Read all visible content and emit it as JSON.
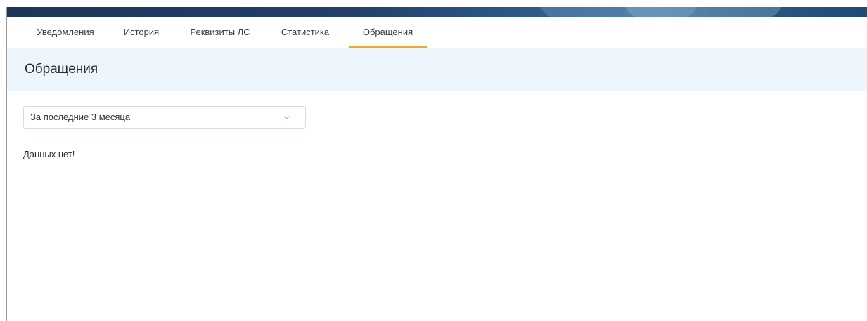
{
  "tabs": [
    {
      "label": "Уведомления",
      "active": false
    },
    {
      "label": "История",
      "active": false
    },
    {
      "label": "Реквизиты ЛС",
      "active": false
    },
    {
      "label": "Статистика",
      "active": false
    },
    {
      "label": "Обращения",
      "active": true
    }
  ],
  "section": {
    "title": "Обращения"
  },
  "filter": {
    "selected_value": "За последние 3 месяца"
  },
  "content": {
    "empty_message": "Данных нет!"
  },
  "colors": {
    "active_tab_indicator": "#f0a630",
    "header_background": "#eef6fd",
    "banner": "#1d3658"
  },
  "icons": {
    "select_arrow": "chevron-down-icon"
  }
}
